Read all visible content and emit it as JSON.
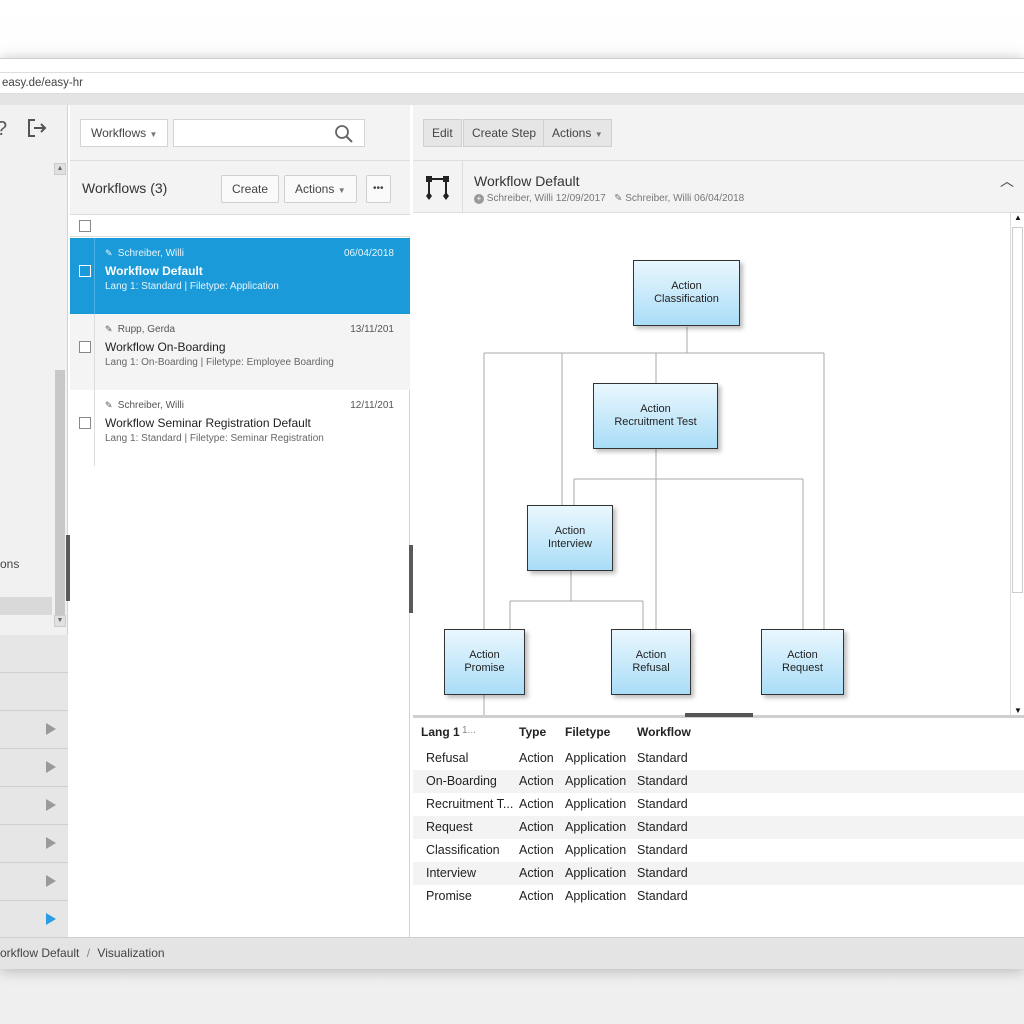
{
  "browser": {
    "url": "easy.de/easy-hr"
  },
  "left_nav": {
    "partial_label": "ons",
    "icons": [
      "help-icon",
      "logout-icon"
    ]
  },
  "list_toolbar": {
    "dropdown_label": "Workflows",
    "search_placeholder": ""
  },
  "list_header": {
    "title": "Workflows (3)",
    "create_label": "Create",
    "actions_label": "Actions",
    "more_label": "•••"
  },
  "records": [
    {
      "editor": "Schreiber, Willi",
      "date": "06/04/2018",
      "name": "Workflow Default",
      "meta": "Lang 1: Standard  |  Filetype: Application"
    },
    {
      "editor": "Rupp, Gerda",
      "date": "13/11/201",
      "name": "Workflow On-Boarding",
      "meta": "Lang 1: On-Boarding  |  Filetype: Employee Boarding"
    },
    {
      "editor": "Schreiber, Willi",
      "date": "12/11/201",
      "name": "Workflow Seminar Registration Default",
      "meta": "Lang 1: Standard  |  Filetype: Seminar Registration"
    }
  ],
  "detail_toolbar": {
    "edit_label": "Edit",
    "create_step_label": "Create Step",
    "actions_label": "Actions"
  },
  "detail_header": {
    "title": "Workflow Default",
    "created": "Schreiber, Willi  12/09/2017",
    "modified": "Schreiber, Willi  06/04/2018"
  },
  "diagram": {
    "nodes": {
      "classification": [
        "Action",
        "Classification"
      ],
      "recruitment_test": [
        "Action",
        "Recruitment Test"
      ],
      "interview": [
        "Action",
        "Interview"
      ],
      "promise": [
        "Action",
        "Promise"
      ],
      "refusal": [
        "Action",
        "Refusal"
      ],
      "request": [
        "Action",
        "Request"
      ]
    }
  },
  "grid": {
    "headers": [
      "Lang 1",
      "1...",
      "Type",
      "Filetype",
      "Workflow"
    ],
    "rows": [
      [
        "Refusal",
        "Action",
        "Application",
        "Standard"
      ],
      [
        "On-Boarding",
        "Action",
        "Application",
        "Standard"
      ],
      [
        "Recruitment T...",
        "Action",
        "Application",
        "Standard"
      ],
      [
        "Request",
        "Action",
        "Application",
        "Standard"
      ],
      [
        "Classification",
        "Action",
        "Application",
        "Standard"
      ],
      [
        "Interview",
        "Action",
        "Application",
        "Standard"
      ],
      [
        "Promise",
        "Action",
        "Application",
        "Standard"
      ]
    ]
  },
  "breadcrumb": {
    "current": "orkflow Default",
    "separator": "/",
    "page": "Visualization"
  },
  "colors": {
    "selection": "#1a9ad9",
    "node_fill": "#a9ddf7",
    "accent_arrow": "#2a9de4"
  }
}
